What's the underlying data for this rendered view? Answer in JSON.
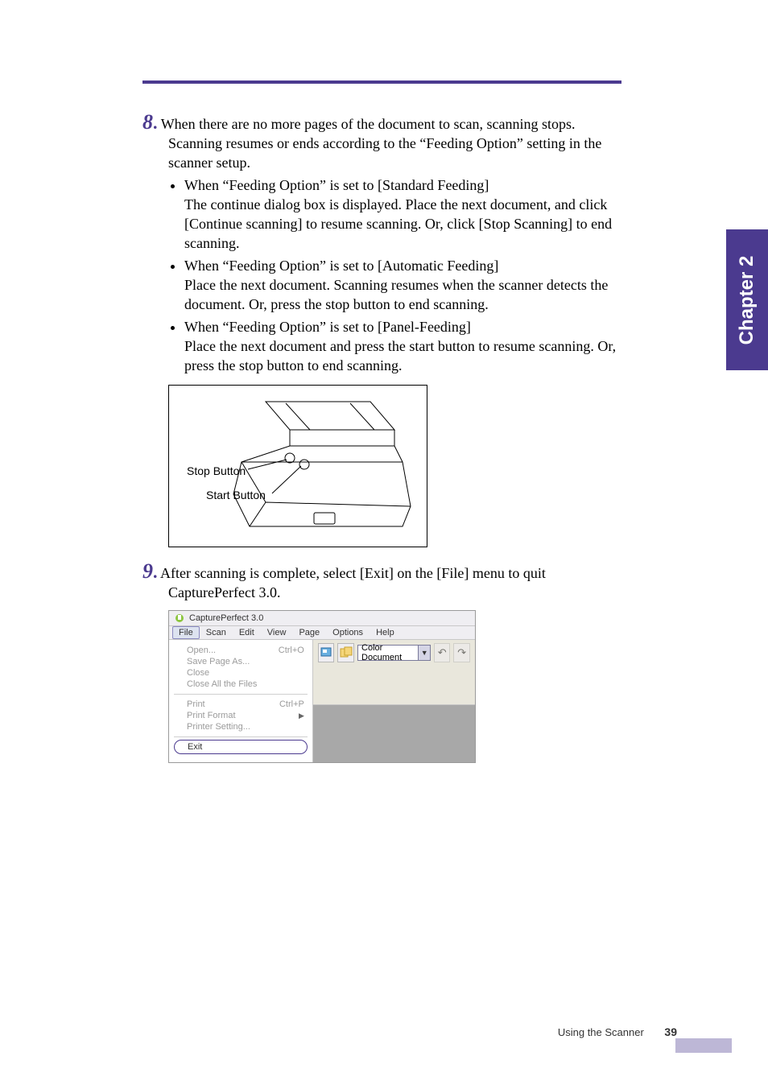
{
  "chapter_tab": "Chapter 2",
  "step8": {
    "num": "8",
    "lead": "When there are no more pages of the document to scan, scanning stops. Scanning resumes or ends according to the “Feeding Option” setting in the scanner setup.",
    "bullets": [
      "When “Feeding Option” is set to [Standard Feeding]\nThe continue dialog box is displayed. Place the next document, and click [Continue scanning] to resume scanning. Or, click [Stop Scanning] to end scanning.",
      "When “Feeding Option” is set to [Automatic Feeding]\nPlace the next document. Scanning resumes when the scanner detects the document. Or, press the stop button to end scanning.",
      "When “Feeding Option” is set to [Panel-Feeding]\nPlace the next document and press the start button to resume scanning. Or, press the stop button to end scanning."
    ],
    "figure": {
      "stop_label": "Stop Button",
      "start_label": "Start Button"
    }
  },
  "step9": {
    "num": "9",
    "lead": "After scanning is complete, select [Exit] on the [File] menu to quit CapturePerfect 3.0."
  },
  "screenshot": {
    "app_title": "CapturePerfect 3.0",
    "menus": [
      "File",
      "Scan",
      "Edit",
      "View",
      "Page",
      "Options",
      "Help"
    ],
    "dropdown": {
      "group1": [
        {
          "label": "Open...",
          "shortcut": "Ctrl+O"
        },
        {
          "label": "Save Page As...",
          "shortcut": ""
        },
        {
          "label": "Close",
          "shortcut": ""
        },
        {
          "label": "Close All the Files",
          "shortcut": ""
        }
      ],
      "group2": [
        {
          "label": "Print",
          "shortcut": "Ctrl+P"
        },
        {
          "label": "Print Format",
          "shortcut": "",
          "submenu": true
        },
        {
          "label": "Printer Setting...",
          "shortcut": ""
        }
      ],
      "exit": {
        "label": "Exit",
        "shortcut": ""
      }
    },
    "toolbar": {
      "dropdown_value": "Color Document"
    }
  },
  "footer": {
    "section": "Using the Scanner",
    "page": "39"
  }
}
